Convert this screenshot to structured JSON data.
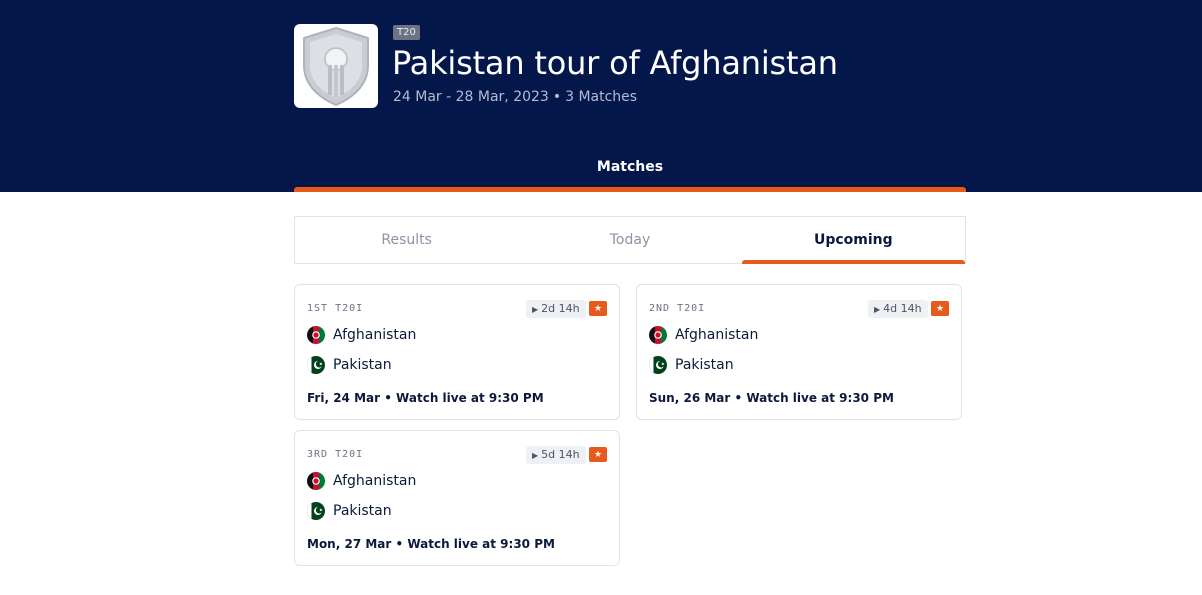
{
  "series": {
    "format": "T20",
    "title": "Pakistan tour of Afghanistan",
    "dates": "24 Mar - 28 Mar, 2023",
    "separator": "•",
    "match_count": "3 Matches"
  },
  "nav": {
    "main_tab": "Matches"
  },
  "subtabs": [
    {
      "label": "Results",
      "active": false
    },
    {
      "label": "Today",
      "active": false
    },
    {
      "label": "Upcoming",
      "active": true
    }
  ],
  "colors": {
    "header_bg": "#03174a",
    "accent": "#e8591b"
  },
  "matches": [
    {
      "label": "1ST T20I",
      "countdown": "2d 14h",
      "team1": "Afghanistan",
      "team2": "Pakistan",
      "when": "Fri, 24 Mar • Watch live at 9:30 PM"
    },
    {
      "label": "2ND T20I",
      "countdown": "4d 14h",
      "team1": "Afghanistan",
      "team2": "Pakistan",
      "when": "Sun, 26 Mar • Watch live at 9:30 PM"
    },
    {
      "label": "3RD T20I",
      "countdown": "5d 14h",
      "team1": "Afghanistan",
      "team2": "Pakistan",
      "when": "Mon, 27 Mar • Watch live at 9:30 PM"
    }
  ],
  "icons": {
    "series_logo": "shield-cricket-logo-icon",
    "play": "play-triangle-icon",
    "ticket": "ticket-icon",
    "flag_afg": "afghanistan-flag-icon",
    "flag_pak": "pakistan-flag-icon"
  }
}
